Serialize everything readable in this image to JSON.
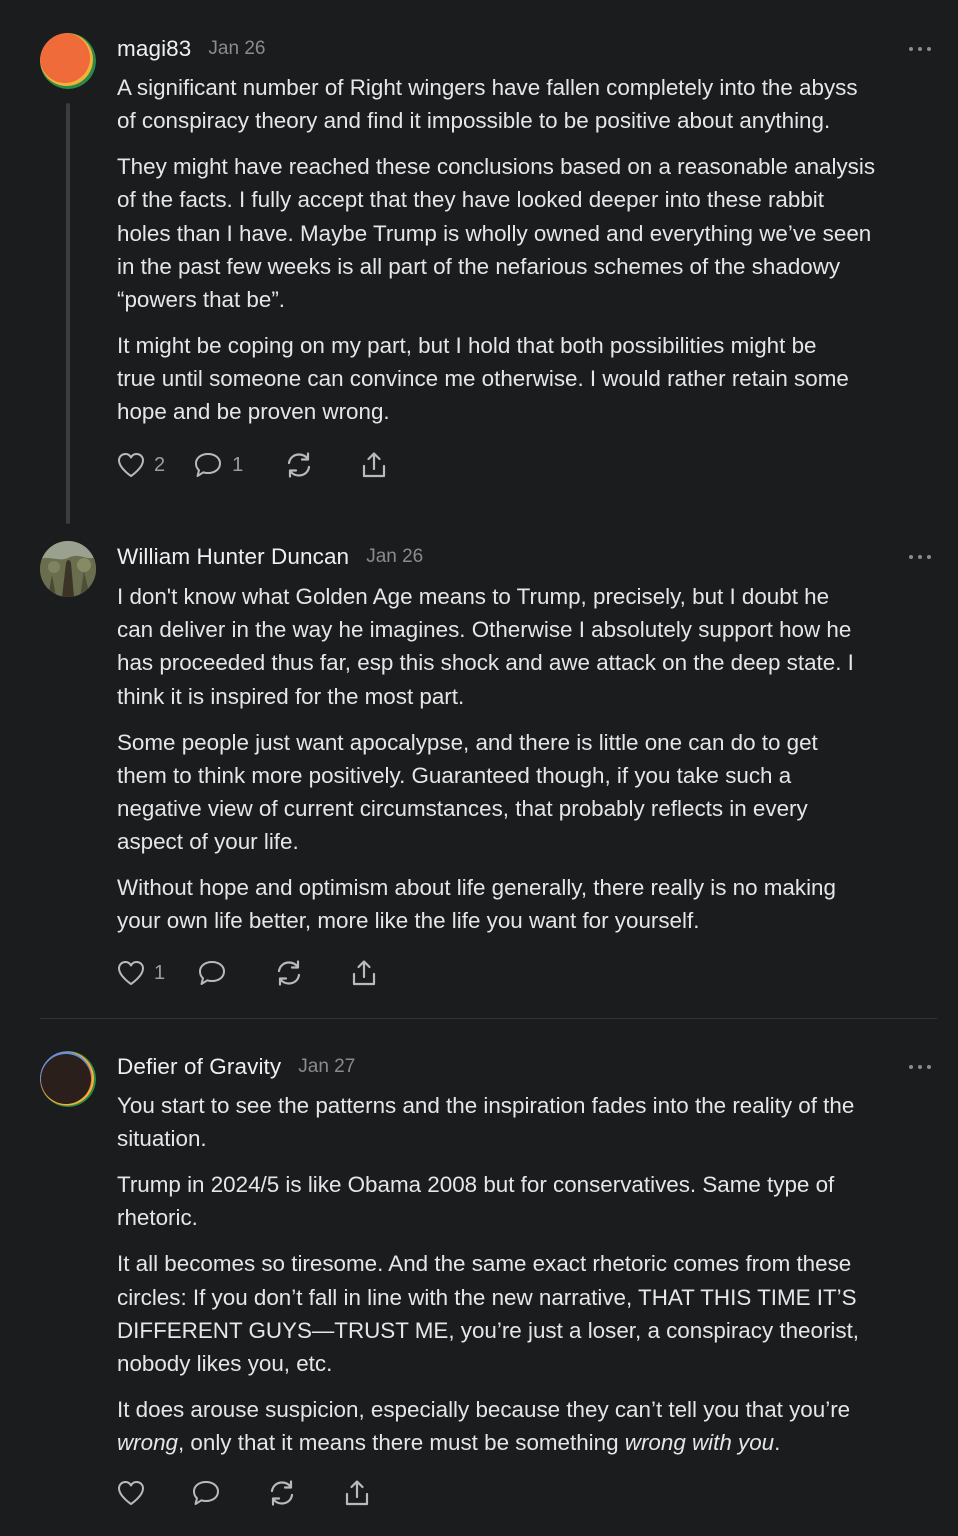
{
  "comments": [
    {
      "author": "magi83",
      "date": "Jan 26",
      "paragraphs": [
        [
          "A significant number of Right wingers have fallen completely into the abyss",
          "of conspiracy theory and find it impossible to be positive about anything."
        ],
        [
          "They might have reached these conclusions based on a reasonable analysis",
          "of the facts. I fully accept that they have looked deeper into these rabbit",
          "holes than I have. Maybe Trump is wholly owned and everything we’ve seen",
          "in the past few weeks is all part of the nefarious schemes of the shadowy",
          "“powers that be”."
        ],
        [
          "It might be coping on my part, but I hold that both possibilities might be",
          "true until someone can convince me otherwise. I would rather retain some",
          "hope and be proven wrong."
        ]
      ],
      "likes": "2",
      "replies": "1"
    },
    {
      "author": "William Hunter Duncan",
      "date": "Jan 26",
      "paragraphs": [
        [
          "I don't know what Golden Age means to Trump, precisely, but I doubt he",
          "can deliver in the way he imagines. Otherwise I absolutely support how he",
          "has proceeded thus far, esp this shock and awe attack on the deep state. I",
          "think it is inspired for the most part."
        ],
        [
          "Some people just want apocalypse, and there is little one can do to get",
          "them to think more positively. Guaranteed though, if you take such a",
          "negative view of current circumstances, that probably reflects in every",
          "aspect of your life."
        ],
        [
          "Without hope and optimism about life generally, there really is no making",
          "your own life better, more like the life you want for yourself."
        ]
      ],
      "likes": "1",
      "replies": ""
    },
    {
      "author": "Defier of Gravity",
      "date": "Jan 27",
      "paragraphs": [
        [
          "You start to see the patterns and the inspiration fades into the reality of the",
          "situation."
        ],
        [
          "Trump in 2024/5 is like Obama 2008 but for conservatives. Same type of",
          "rhetoric."
        ],
        [
          "It all becomes so tiresome. And the same exact rhetoric comes from these",
          "circles: If you don’t fall in line with the new narrative, THAT THIS TIME IT’S",
          "DIFFERENT GUYS—TRUST ME, you’re just a loser, a conspiracy theorist,",
          "nobody likes you, etc."
        ]
      ],
      "last_paragraph": {
        "line1": "It does arouse suspicion, especially because they can’t tell you that you’re",
        "line2_a": "wrong",
        "line2_b": ", only that it means there must be something ",
        "line2_c": "wrong with you",
        "line2_d": "."
      },
      "likes": "",
      "replies": ""
    }
  ],
  "colors": {
    "background": "#1b1c1e",
    "text": "#e6e6e6",
    "muted": "#8a8b8e"
  },
  "icons": [
    "heart-icon",
    "comment-icon",
    "restack-icon",
    "share-icon",
    "more-options-icon"
  ]
}
